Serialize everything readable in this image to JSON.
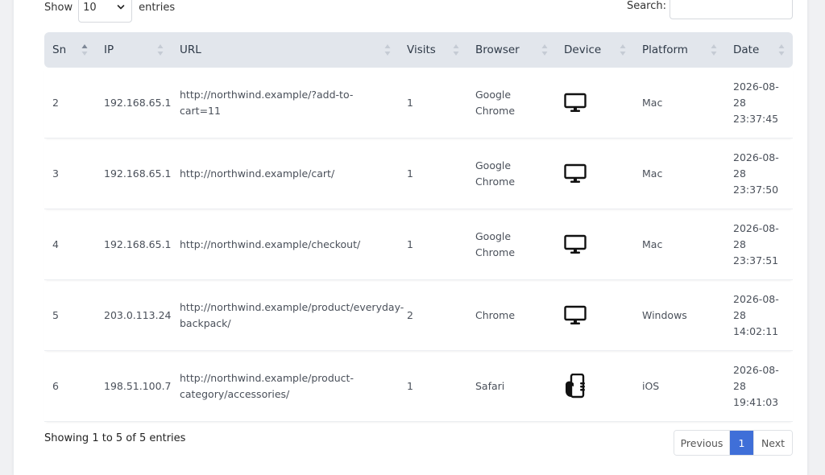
{
  "length_menu": {
    "prefix": "Show",
    "selected": "10",
    "suffix": "entries"
  },
  "search": {
    "label": "Search:",
    "value": ""
  },
  "columns": [
    "Sn",
    "IP",
    "URL",
    "Visits",
    "Browser",
    "Device",
    "Platform",
    "Date"
  ],
  "rows": [
    {
      "sn": "2",
      "ip": "192.168.65.1",
      "url": "http://northwind.example/?add-to-cart=11",
      "visits": "1",
      "browser": "Google Chrome",
      "device": "desktop-icon",
      "platform": "Mac",
      "date": "2026-08-28 23:37:45"
    },
    {
      "sn": "3",
      "ip": "192.168.65.1",
      "url": "http://northwind.example/cart/",
      "visits": "1",
      "browser": "Google Chrome",
      "device": "desktop-icon",
      "platform": "Mac",
      "date": "2026-08-28 23:37:50"
    },
    {
      "sn": "4",
      "ip": "192.168.65.1",
      "url": "http://northwind.example/checkout/",
      "visits": "1",
      "browser": "Google Chrome",
      "device": "desktop-icon",
      "platform": "Mac",
      "date": "2026-08-28 23:37:51"
    },
    {
      "sn": "5",
      "ip": "203.0.113.24",
      "url": "http://northwind.example/product/everyday-backpack/",
      "visits": "2",
      "browser": "Chrome",
      "device": "desktop-icon",
      "platform": "Windows",
      "date": "2026-08-28 14:02:11"
    },
    {
      "sn": "6",
      "ip": "198.51.100.7",
      "url": "http://northwind.example/product-category/accessories/",
      "visits": "1",
      "browser": "Safari",
      "device": "mobile-hand-icon",
      "platform": "iOS",
      "date": "2026-08-28 19:41:03"
    }
  ],
  "info": "Showing 1 to 5 of 5 entries",
  "pagination": {
    "previous": "Previous",
    "current": "1",
    "next": "Next"
  },
  "colors": {
    "header_bg": "#e2e6ec",
    "active_page": "#3f6fd8"
  }
}
